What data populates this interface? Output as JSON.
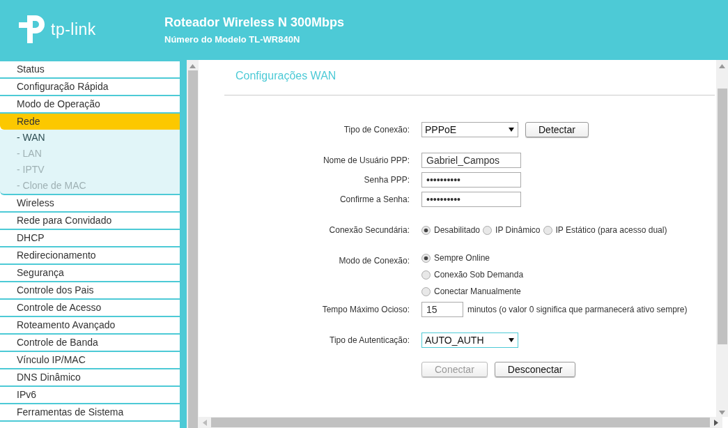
{
  "header": {
    "brand": "tp-link",
    "title": "Roteador Wireless N 300Mbps",
    "model": "Número do Modelo TL-WR840N"
  },
  "sidebar": {
    "items": [
      {
        "label": "Status",
        "selected": false
      },
      {
        "label": "Configuração Rápida",
        "selected": false
      },
      {
        "label": "Modo de Operação",
        "selected": false
      },
      {
        "label": "Rede",
        "selected": true,
        "expanded": true,
        "children": [
          {
            "label": "- WAN",
            "selected": true
          },
          {
            "label": "- LAN",
            "selected": false
          },
          {
            "label": "- IPTV",
            "selected": false
          },
          {
            "label": "- Clone de MAC",
            "selected": false
          }
        ]
      },
      {
        "label": "Wireless",
        "selected": false
      },
      {
        "label": "Rede para Convidado",
        "selected": false
      },
      {
        "label": "DHCP",
        "selected": false
      },
      {
        "label": "Redirecionamento",
        "selected": false
      },
      {
        "label": "Segurança",
        "selected": false
      },
      {
        "label": "Controle dos Pais",
        "selected": false
      },
      {
        "label": "Controle de Acesso",
        "selected": false
      },
      {
        "label": "Roteamento Avançado",
        "selected": false
      },
      {
        "label": "Controle de Banda",
        "selected": false
      },
      {
        "label": "Vínculo IP/MAC",
        "selected": false
      },
      {
        "label": "DNS Dinâmico",
        "selected": false
      },
      {
        "label": "IPv6",
        "selected": false
      },
      {
        "label": "Ferramentas de Sistema",
        "selected": false
      }
    ]
  },
  "content": {
    "title": "Configurações WAN",
    "sections": [
      [
        {
          "kind": "inline",
          "label": "Tipo de Conexão:",
          "controls": [
            {
              "kind": "select",
              "value": "PPPoE",
              "focused": false
            },
            {
              "kind": "button",
              "label": "Detectar",
              "disabled": false
            }
          ]
        }
      ],
      [
        {
          "kind": "inline",
          "label": "Nome de Usuário PPP:",
          "controls": [
            {
              "kind": "text",
              "value": "Gabriel_Campos"
            }
          ]
        },
        {
          "kind": "inline",
          "label": "Senha PPP:",
          "controls": [
            {
              "kind": "password",
              "value": "••••••••••"
            }
          ]
        },
        {
          "kind": "inline",
          "label": "Confirme a Senha:",
          "controls": [
            {
              "kind": "password",
              "value": "••••••••••"
            }
          ]
        }
      ],
      [
        {
          "kind": "inline",
          "label": "Conexão Secundária:",
          "controls": [
            {
              "kind": "radio",
              "label": "Desabilitado",
              "selected": true
            },
            {
              "kind": "radio",
              "label": "IP Dinâmico",
              "selected": false
            },
            {
              "kind": "radio",
              "label": "IP Estático (para acesso dual)",
              "selected": false
            }
          ]
        }
      ],
      [
        {
          "kind": "stacked",
          "label": "Modo de Conexão:",
          "controls": [
            {
              "kind": "radio",
              "label": "Sempre Online",
              "selected": true
            },
            {
              "kind": "radio",
              "label": "Conexão Sob Demanda",
              "selected": false
            },
            {
              "kind": "radio",
              "label": "Conectar Manualmente",
              "selected": false
            }
          ]
        },
        {
          "kind": "inline",
          "label": "Tempo Máximo Ocioso:",
          "controls": [
            {
              "kind": "short-text",
              "value": "15"
            },
            {
              "kind": "note",
              "text": "minutos (o valor 0 significa que parmanecerá ativo sempre)"
            }
          ]
        }
      ],
      [
        {
          "kind": "inline",
          "label": "Tipo de Autenticação:",
          "controls": [
            {
              "kind": "select",
              "value": "AUTO_AUTH",
              "focused": true
            }
          ]
        },
        {
          "kind": "inline",
          "controls": [
            {
              "kind": "button",
              "label": "Conectar",
              "disabled": true
            },
            {
              "kind": "button",
              "label": "Desconectar",
              "disabled": false
            }
          ]
        }
      ]
    ]
  }
}
